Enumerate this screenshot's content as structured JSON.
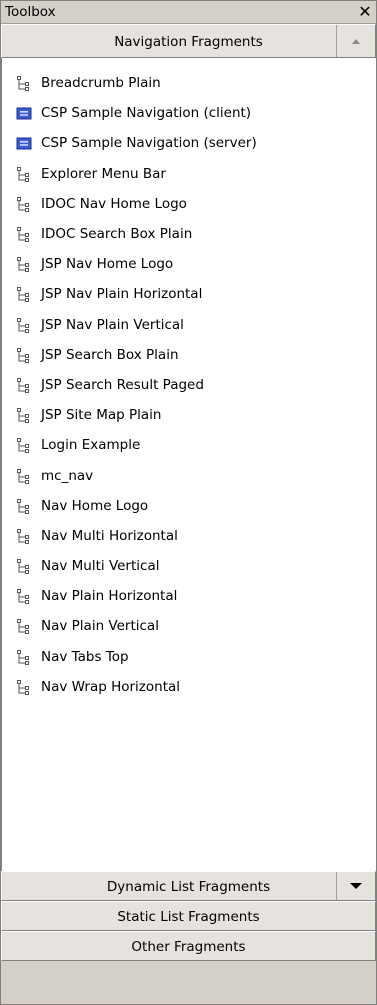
{
  "window": {
    "title": "Toolbox",
    "close_glyph": "✕"
  },
  "active_section": {
    "label": "Navigation Fragments",
    "chevron": "chevron-up-icon",
    "items": [
      {
        "label": "Breadcrumb Plain",
        "icon": "tree-fragment-icon"
      },
      {
        "label": "CSP Sample Navigation (client)",
        "icon": "csp-fragment-icon"
      },
      {
        "label": "CSP Sample Navigation (server)",
        "icon": "csp-fragment-icon"
      },
      {
        "label": "Explorer Menu Bar",
        "icon": "tree-fragment-icon"
      },
      {
        "label": "IDOC Nav Home Logo",
        "icon": "tree-fragment-icon"
      },
      {
        "label": "IDOC Search Box Plain",
        "icon": "tree-fragment-icon"
      },
      {
        "label": "JSP Nav Home Logo",
        "icon": "tree-fragment-icon"
      },
      {
        "label": "JSP Nav Plain Horizontal",
        "icon": "tree-fragment-icon"
      },
      {
        "label": "JSP Nav Plain Vertical",
        "icon": "tree-fragment-icon"
      },
      {
        "label": "JSP Search Box Plain",
        "icon": "tree-fragment-icon"
      },
      {
        "label": "JSP Search Result Paged",
        "icon": "tree-fragment-icon"
      },
      {
        "label": "JSP Site Map Plain",
        "icon": "tree-fragment-icon"
      },
      {
        "label": "Login Example",
        "icon": "tree-fragment-icon"
      },
      {
        "label": "mc_nav",
        "icon": "tree-fragment-icon"
      },
      {
        "label": "Nav Home Logo",
        "icon": "tree-fragment-icon"
      },
      {
        "label": "Nav Multi Horizontal",
        "icon": "tree-fragment-icon"
      },
      {
        "label": "Nav Multi Vertical",
        "icon": "tree-fragment-icon"
      },
      {
        "label": "Nav Plain Horizontal",
        "icon": "tree-fragment-icon"
      },
      {
        "label": "Nav Plain Vertical",
        "icon": "tree-fragment-icon"
      },
      {
        "label": "Nav Tabs Top",
        "icon": "tree-fragment-icon"
      },
      {
        "label": "Nav Wrap Horizontal",
        "icon": "tree-fragment-icon"
      }
    ]
  },
  "other_sections": [
    {
      "label": "Dynamic List Fragments",
      "chevron": "chevron-down-icon"
    },
    {
      "label": "Static List Fragments"
    },
    {
      "label": "Other Fragments"
    }
  ],
  "colors": {
    "panel_bg": "#d4d0c8",
    "list_bg": "#ffffff",
    "csp_icon_blue": "#3b5bd6",
    "tree_icon_gray": "#555555"
  }
}
